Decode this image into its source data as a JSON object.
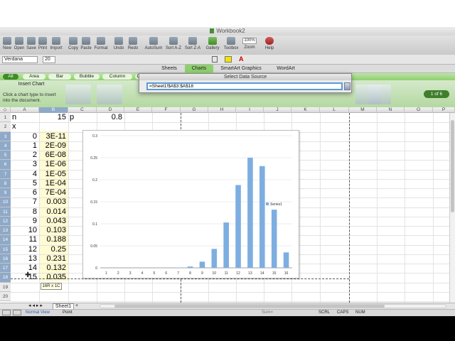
{
  "window": {
    "title": "Workbook2"
  },
  "toolbar": {
    "items": [
      "New",
      "Open",
      "Save",
      "Print",
      "Import",
      "Copy",
      "Paste",
      "Format",
      "Undo",
      "Redo",
      "AutoSum",
      "Sort A-Z",
      "Sort Z-A",
      "Gallery",
      "Toolbox",
      "Zoom",
      "Help"
    ],
    "zoom": "100%"
  },
  "format": {
    "font": "Verdana",
    "size": "20"
  },
  "ribbon": {
    "tabs": [
      "Sheets",
      "Charts",
      "SmartArt Graphics",
      "WordArt"
    ]
  },
  "chart_gallery": {
    "categories": [
      "All",
      "Area",
      "Bar",
      "Bubble",
      "Column",
      "Do"
    ],
    "label": "Insert Chart",
    "hint": "Click a chart type to insert into the document.",
    "page": "1 of 6"
  },
  "dialog": {
    "title": "Select Data Source",
    "range": "=Sheet1!$A$3:$A$18"
  },
  "grid": {
    "columns": [
      "A",
      "B",
      "C",
      "D",
      "E",
      "F",
      "G",
      "H",
      "I",
      "J",
      "K",
      "L",
      "M",
      "N",
      "O",
      "P"
    ],
    "rows": [
      "1",
      "2",
      "3",
      "4",
      "5",
      "6",
      "7",
      "8",
      "9",
      "10",
      "11",
      "12",
      "13",
      "14",
      "15",
      "16",
      "17",
      "18",
      "19",
      "20"
    ],
    "A1": "n",
    "B1": "15",
    "C1": "p",
    "D1": "0.8",
    "A2": "x",
    "colA": [
      "0",
      "1",
      "2",
      "3",
      "4",
      "5",
      "6",
      "7",
      "8",
      "9",
      "10",
      "11",
      "12",
      "13",
      "14",
      "15"
    ],
    "colB": [
      "3E-11",
      "2E-09",
      "6E-08",
      "1E-06",
      "1E-05",
      "1E-04",
      "7E-04",
      "0.003",
      "0.014",
      "0.043",
      "0.103",
      "0.188",
      "0.25",
      "0.231",
      "0.132",
      "0.035"
    ],
    "size_tip": "16R x 1C"
  },
  "chart_data": {
    "type": "bar",
    "categories": [
      "1",
      "2",
      "3",
      "4",
      "5",
      "6",
      "7",
      "8",
      "9",
      "10",
      "11",
      "12",
      "13",
      "14",
      "15",
      "16"
    ],
    "series": [
      {
        "name": "Series1",
        "values": [
          3e-11,
          2e-09,
          6e-08,
          1e-06,
          1e-05,
          0.0001,
          0.0007,
          0.003,
          0.014,
          0.043,
          0.103,
          0.188,
          0.25,
          0.231,
          0.132,
          0.035
        ]
      }
    ],
    "yticks": [
      "0",
      "0.05",
      "0.1",
      "0.15",
      "0.2",
      "0.25",
      "0.3"
    ],
    "ylim": [
      0,
      0.3
    ],
    "legend": "right",
    "bar_color": "#7eaee0"
  },
  "sheet_tabs": {
    "active": "Sheet1"
  },
  "status": {
    "view": "Normal View",
    "mode": "Point",
    "sum": "Sum=",
    "scrl": "SCRL",
    "caps": "CAPS",
    "num": "NUM"
  }
}
